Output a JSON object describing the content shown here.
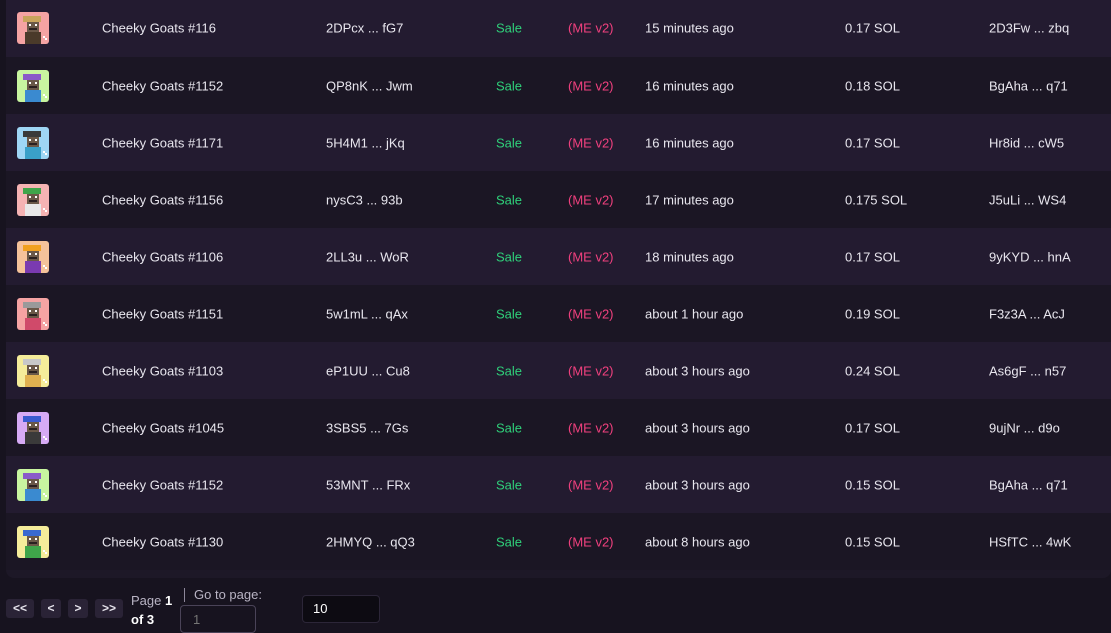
{
  "rows": [
    {
      "name": "Cheeky Goats #116",
      "mint": "2DPcx ... fG7",
      "type": "Sale",
      "market": "(ME v2)",
      "time": "15 minutes ago",
      "price": "0.17 SOL",
      "buyer": "2D3Fw ... zbq",
      "bg": "#f5a3a3",
      "hat": "#c9a45c",
      "body": "#4a3a2a"
    },
    {
      "name": "Cheeky Goats #1152",
      "mint": "QP8nK ... Jwm",
      "type": "Sale",
      "market": "(ME v2)",
      "time": "16 minutes ago",
      "price": "0.18 SOL",
      "buyer": "BgAha ... q71",
      "bg": "#c8f5a0",
      "hat": "#8a5ac9",
      "body": "#3a8ad0"
    },
    {
      "name": "Cheeky Goats #1171",
      "mint": "5H4M1 ... jKq",
      "type": "Sale",
      "market": "(ME v2)",
      "time": "16 minutes ago",
      "price": "0.17 SOL",
      "buyer": "Hr8id ... cW5",
      "bg": "#9fd6f5",
      "hat": "#3a3a3a",
      "body": "#3aa0c8"
    },
    {
      "name": "Cheeky Goats #1156",
      "mint": "nysC3 ... 93b",
      "type": "Sale",
      "market": "(ME v2)",
      "time": "17 minutes ago",
      "price": "0.175 SOL",
      "buyer": "J5uLi ... WS4",
      "bg": "#f5b3b3",
      "hat": "#3fa54a",
      "body": "#e8e8e8"
    },
    {
      "name": "Cheeky Goats #1106",
      "mint": "2LL3u ... WoR",
      "type": "Sale",
      "market": "(ME v2)",
      "time": "18 minutes ago",
      "price": "0.17 SOL",
      "buyer": "9yKYD ... hnA",
      "bg": "#f5c29a",
      "hat": "#f0a020",
      "body": "#7a3ab0"
    },
    {
      "name": "Cheeky Goats #1151",
      "mint": "5w1mL ... qAx",
      "type": "Sale",
      "market": "(ME v2)",
      "time": "about 1 hour ago",
      "price": "0.19 SOL",
      "buyer": "F3z3A ... AcJ",
      "bg": "#f5a3a3",
      "hat": "#9a9a9a",
      "body": "#d04a6a"
    },
    {
      "name": "Cheeky Goats #1103",
      "mint": "eP1UU ... Cu8",
      "type": "Sale",
      "market": "(ME v2)",
      "time": "about 3 hours ago",
      "price": "0.24 SOL",
      "buyer": "As6gF ... n57",
      "bg": "#f5ec9a",
      "hat": "#c8c8c8",
      "body": "#e0b050"
    },
    {
      "name": "Cheeky Goats #1045",
      "mint": "3SBS5 ... 7Gs",
      "type": "Sale",
      "market": "(ME v2)",
      "time": "about 3 hours ago",
      "price": "0.17 SOL",
      "buyer": "9ujNr ... d9o",
      "bg": "#d6aaf5",
      "hat": "#3a5ad0",
      "body": "#3a3a3a"
    },
    {
      "name": "Cheeky Goats #1152",
      "mint": "53MNT ... FRx",
      "type": "Sale",
      "market": "(ME v2)",
      "time": "about 3 hours ago",
      "price": "0.15 SOL",
      "buyer": "BgAha ... q71",
      "bg": "#c8f5a0",
      "hat": "#8a5ac9",
      "body": "#3a8ad0"
    },
    {
      "name": "Cheeky Goats #1130",
      "mint": "2HMYQ ... qQ3",
      "type": "Sale",
      "market": "(ME v2)",
      "time": "about 8 hours ago",
      "price": "0.15 SOL",
      "buyer": "HSfTC ... 4wK",
      "bg": "#f5ec9a",
      "hat": "#3a6ad0",
      "body": "#3fa54a"
    }
  ],
  "pager": {
    "first": "<<",
    "prev": "<",
    "next": ">",
    "last": ">>",
    "page_word": "Page",
    "page_current": "1",
    "page_of": "of 3",
    "goto_label": "Go to page:",
    "goto_placeholder": "1",
    "page_size": "10"
  }
}
